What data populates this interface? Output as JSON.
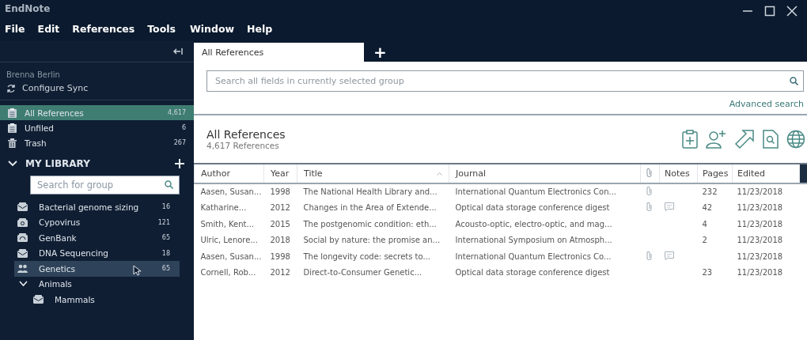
{
  "window": {
    "title": "EndNote"
  },
  "menu": [
    "File",
    "Edit",
    "References",
    "Tools",
    "Window",
    "Help"
  ],
  "sidebar": {
    "user": "Brenna Berlin",
    "sync": "Configure Sync",
    "items": [
      {
        "label": "All References",
        "count": "4,617",
        "kind": "all",
        "selected": true
      },
      {
        "label": "Unfiled",
        "count": "6",
        "kind": "unfiled",
        "selected": false
      },
      {
        "label": "Trash",
        "count": "267",
        "kind": "trash",
        "selected": false
      }
    ],
    "library": {
      "title": "MY LIBRARY",
      "expanded": true,
      "search_placeholder": "Search for group",
      "groups": [
        {
          "label": "Bacterial genome sizing",
          "count": "16",
          "kind": "group",
          "selected": false
        },
        {
          "label": "Cypovirus",
          "count": "121",
          "kind": "smart",
          "selected": false
        },
        {
          "label": "GenBank",
          "count": "65",
          "kind": "online",
          "selected": false
        },
        {
          "label": "DNA Sequencing",
          "count": "18",
          "kind": "group",
          "selected": false
        },
        {
          "label": "Genetics",
          "count": "65",
          "kind": "shared",
          "selected": true
        },
        {
          "label": "Animals",
          "kind": "set",
          "expanded": true,
          "selected": false,
          "children": [
            {
              "label": "Mammals",
              "kind": "group",
              "selected": false
            }
          ]
        }
      ]
    }
  },
  "tabs": [
    {
      "label": "All References",
      "selected": true
    },
    {
      "label": "+",
      "selected": false
    }
  ],
  "search": {
    "placeholder": "Search all fields in currently selected group",
    "advanced": "Advanced search"
  },
  "header": {
    "title": "All References",
    "count": "4,617 References"
  },
  "table": {
    "columns": [
      "Author",
      "Year",
      "Title",
      "Journal",
      "Notes",
      "Pages",
      "Edited"
    ],
    "rows": [
      {
        "author": "Aasen, Susan...",
        "year": "1998",
        "title": "The National Health Library and...",
        "journal": "International Quantum Electronics Con...",
        "attachment": true,
        "note": false,
        "pages": "232",
        "edited": "11/23/2018"
      },
      {
        "author": "Katharine...",
        "year": "2012",
        "title": "Changes in the Area of Extende...",
        "journal": "Optical data storage conference digest",
        "attachment": true,
        "note": true,
        "pages": "42",
        "edited": "11/23/2018"
      },
      {
        "author": "Smith, Kent...",
        "year": "2015",
        "title": "The postgenomic condition: eth...",
        "journal": "Acousto-optic, electro-optic, and mag...",
        "attachment": false,
        "note": false,
        "pages": "4",
        "edited": "11/23/2018"
      },
      {
        "author": "Ulric, Lenore...",
        "year": "2018",
        "title": "Social by nature: the promise an...",
        "journal": "International Symposium on Atmosph...",
        "attachment": false,
        "note": false,
        "pages": "2",
        "edited": "11/23/2018"
      },
      {
        "author": "Aasen, Susan...",
        "year": "1998",
        "title": "The longevity code: secrets to...",
        "journal": "International Quantum Electronics Co...",
        "attachment": true,
        "note": true,
        "pages": "",
        "edited": "11/23/2018"
      },
      {
        "author": "Cornell, Rob...",
        "year": "2012",
        "title": "Direct-to-Consumer Genetic...",
        "journal": "Optical data storage conference digest",
        "attachment": false,
        "note": false,
        "pages": "23",
        "edited": "11/23/2018"
      }
    ]
  }
}
